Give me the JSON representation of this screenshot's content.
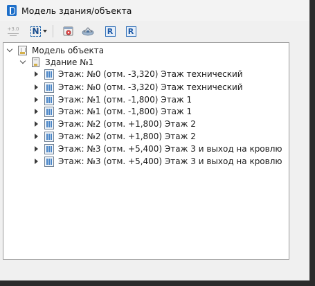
{
  "window": {
    "title": "Модель здания/объекта"
  },
  "toolbar": {
    "items": [
      {
        "name": "elevation-icon",
        "label": "+3.0"
      },
      {
        "name": "numbering-icon",
        "label": "N"
      },
      {
        "name": "settings-icon"
      },
      {
        "name": "view-icon"
      },
      {
        "name": "revit-export-icon",
        "label": "R"
      },
      {
        "name": "revit-import-icon",
        "label": "R"
      }
    ]
  },
  "tree": {
    "root": {
      "label": "Модель объекта",
      "children": [
        {
          "label": "Здание №1",
          "floors": [
            {
              "label": "Этаж: №0 (отм. -3,320) Этаж технический"
            },
            {
              "label": "Этаж: №0 (отм. -3,320) Этаж технический"
            },
            {
              "label": "Этаж: №1 (отм. -1,800) Этаж 1"
            },
            {
              "label": "Этаж: №1 (отм. -1,800) Этаж 1"
            },
            {
              "label": "Этаж: №2 (отм. +1,800) Этаж 2"
            },
            {
              "label": "Этаж: №2 (отм. +1,800) Этаж 2"
            },
            {
              "label": "Этаж: №3 (отм. +5,400) Этаж 3 и выход на кровлю"
            },
            {
              "label": "Этаж: №3 (отм. +5,400) Этаж 3 и выход на кровлю"
            }
          ]
        }
      ]
    }
  }
}
